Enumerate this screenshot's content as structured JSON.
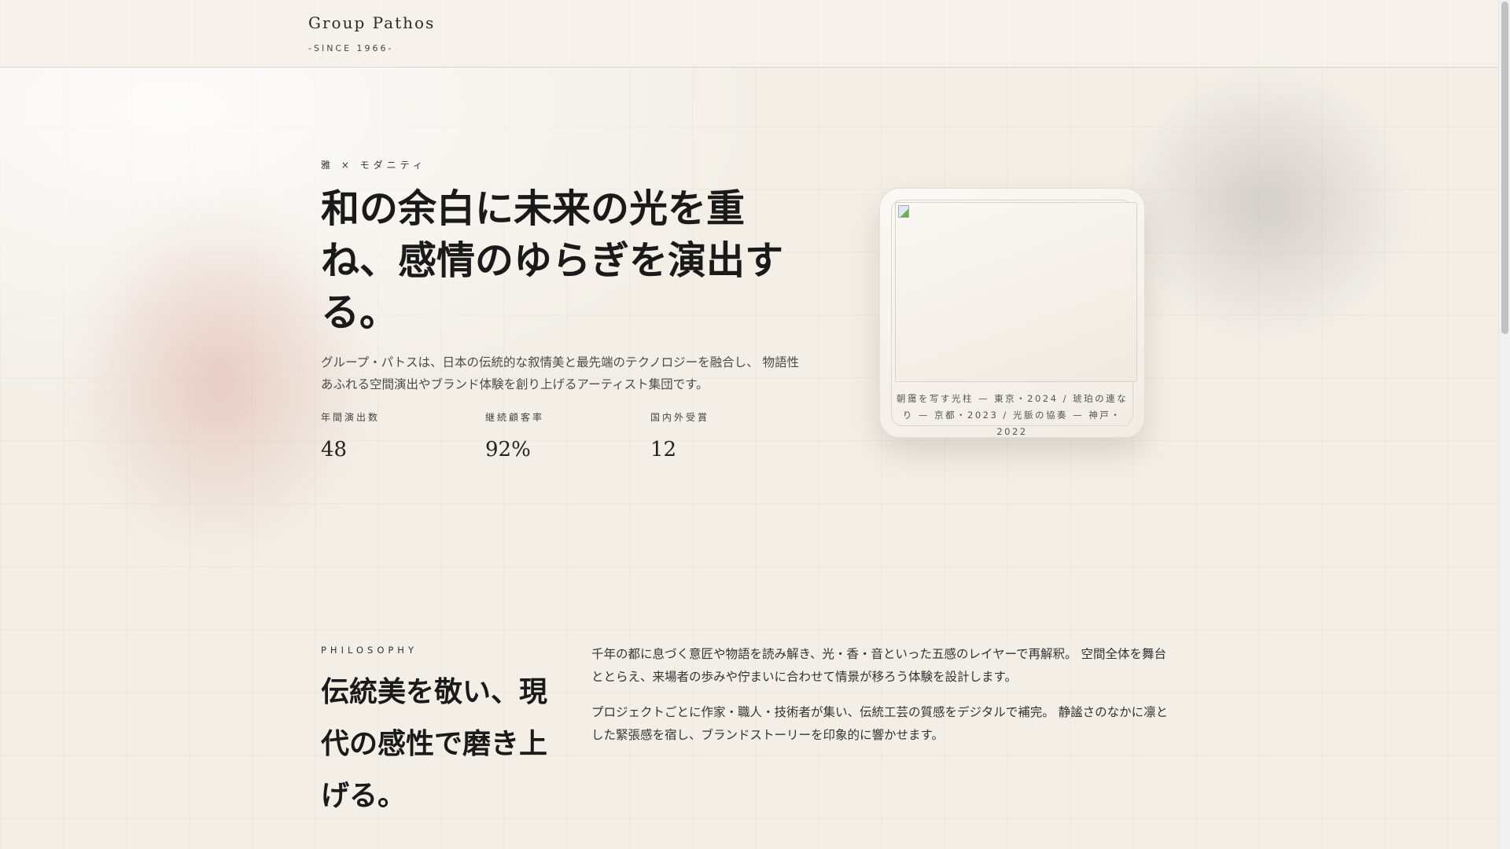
{
  "header": {
    "logo": "Group Pathos",
    "since": "-SINCE 1966-"
  },
  "hero": {
    "eyebrow": "雅 × モダニティ",
    "title": "和の余白に未来の光を重ね、感情のゆらぎを演出する。",
    "lead": "グループ・パトスは、日本の伝統的な叙情美と最先端のテクノロジーを融合し、 物語性あふれる空間演出やブランド体験を創り上げるアーティスト集団です。",
    "stats": [
      {
        "label": "年間演出数",
        "value": "48"
      },
      {
        "label": "継続顧客率",
        "value": "92%"
      },
      {
        "label": "国内外受賞",
        "value": "12"
      }
    ]
  },
  "card": {
    "caption": "朝靄を写す光柱 — 東京・2024 / 琥珀の連なり — 京都・2023 / 光脈の協奏 — 神戸・2022"
  },
  "philosophy": {
    "label": "PHILOSOPHY",
    "title": "伝統美を敬い、現代の感性で磨き上げる。",
    "paragraphs": [
      "千年の都に息づく意匠や物語を読み解き、光・香・音といった五感のレイヤーで再解釈。 空間全体を舞台ととらえ、来場者の歩みや佇まいに合わせて情景が移ろう体験を設計します。",
      "プロジェクトごとに作家・職人・技術者が集い、伝統工芸の質感をデジタルで補完。 静謐さのなかに凛とした緊張感を宿し、ブランドストーリーを印象的に響かせます。"
    ]
  }
}
